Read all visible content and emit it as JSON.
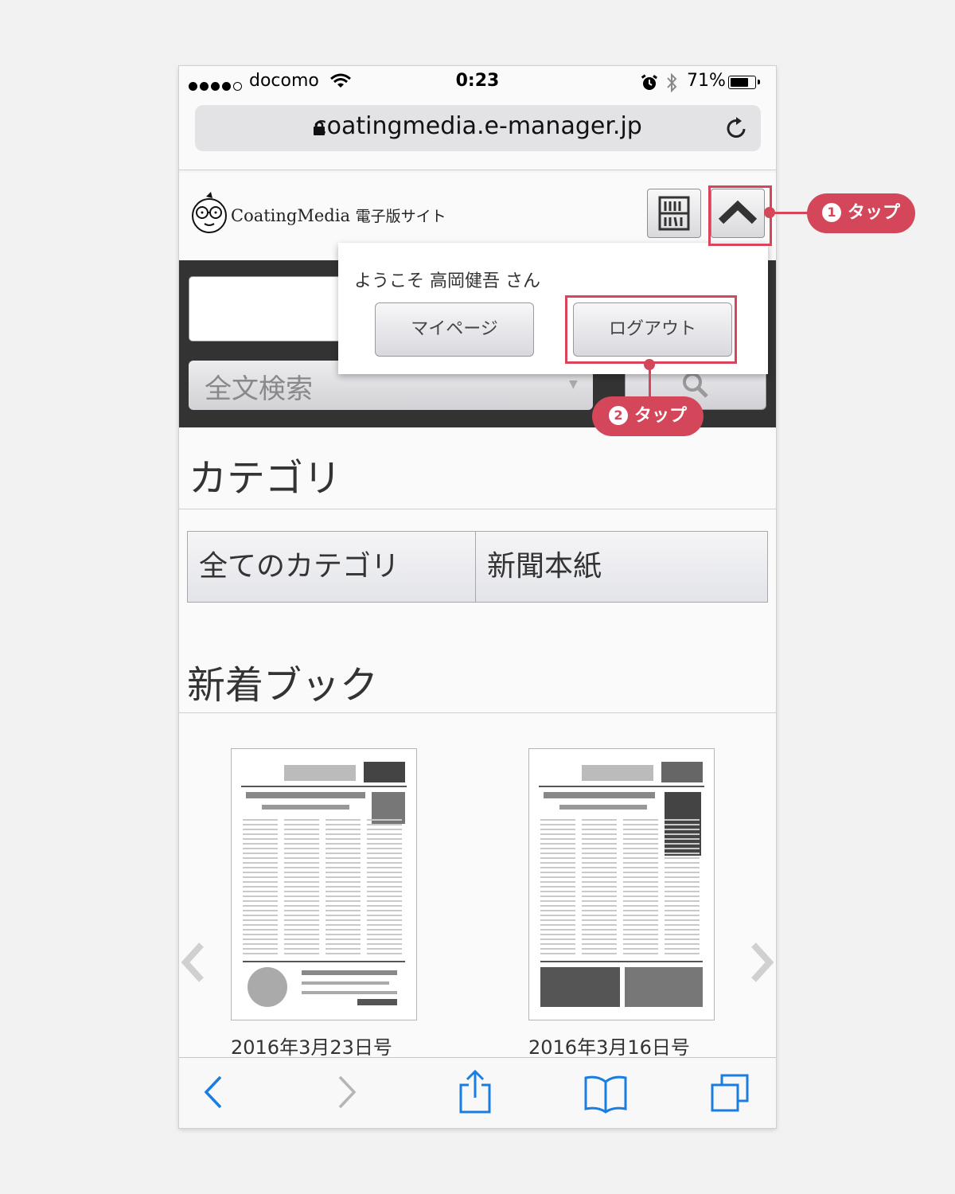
{
  "status_bar": {
    "carrier": "docomo",
    "time": "0:23",
    "battery": "71%",
    "signal_bars_filled": 4,
    "battery_level": 0.71
  },
  "browser": {
    "url": "coatingmedia.e-manager.jp"
  },
  "header": {
    "logo_name": "CoatingMedia",
    "logo_sub": "電子版サイト"
  },
  "dropdown": {
    "welcome": "ようこそ 高岡健吾 さん",
    "mypage_label": "マイページ",
    "logout_label": "ログアウト"
  },
  "search": {
    "mode": "全文検索"
  },
  "categories": {
    "title": "カテゴリ",
    "items": [
      {
        "label": "全てのカテゴリ"
      },
      {
        "label": "新聞本紙"
      }
    ]
  },
  "new_books": {
    "title": "新着ブック",
    "items": [
      {
        "caption": "2016年3月23日号"
      },
      {
        "caption": "2016年3月16日号"
      }
    ]
  },
  "annotations": {
    "step1": {
      "number": "1",
      "label": "タップ"
    },
    "step2": {
      "number": "2",
      "label": "タップ"
    }
  },
  "colors": {
    "annotation": "#d44659",
    "dark_bar": "#333333",
    "ios_blue": "#1a7ee0"
  },
  "icons": [
    "lock-icon",
    "reload-icon",
    "wifi-icon",
    "alarm-icon",
    "bluetooth-icon",
    "bookshelf-icon",
    "chevron-up-icon",
    "search-icon",
    "chevron-left-icon",
    "chevron-right-icon",
    "back-icon",
    "forward-icon",
    "share-icon",
    "bookmarks-icon",
    "tabs-icon"
  ]
}
